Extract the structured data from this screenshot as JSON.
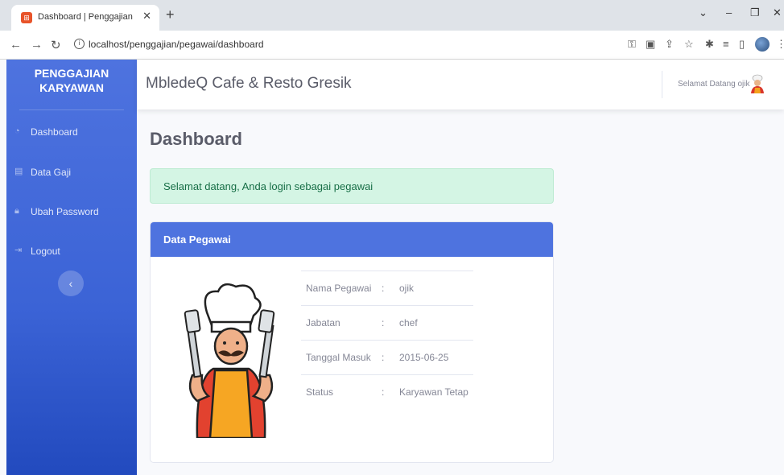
{
  "browser": {
    "tab_title": "Dashboard | Penggajian",
    "url": "localhost/penggajian/pegawai/dashboard"
  },
  "sidebar": {
    "brand_line1": "PENGGAJIAN",
    "brand_line2": "KARYAWAN",
    "items": [
      {
        "label": "Dashboard",
        "icon": "dashboard-icon"
      },
      {
        "label": "Data Gaji",
        "icon": "table-icon"
      },
      {
        "label": "Ubah Password",
        "icon": "lock-icon"
      },
      {
        "label": "Logout",
        "icon": "logout-icon"
      }
    ]
  },
  "topbar": {
    "title": "MbledeQ Cafe & Resto Gresik",
    "greeting": "Selamat Datang ojik"
  },
  "main": {
    "page_title": "Dashboard",
    "alert": "Selamat datang, Anda login sebagai pegawai",
    "card": {
      "title": "Data Pegawai",
      "rows": [
        {
          "label": "Nama Pegawai",
          "value": "ojik"
        },
        {
          "label": "Jabatan",
          "value": "chef"
        },
        {
          "label": "Tanggal Masuk",
          "value": "2015-06-25"
        },
        {
          "label": "Status",
          "value": "Karyawan Tetap"
        }
      ]
    }
  },
  "colors": {
    "primary": "#4e73df",
    "success_bg": "#d4f5e4",
    "success_text": "#176e46"
  }
}
